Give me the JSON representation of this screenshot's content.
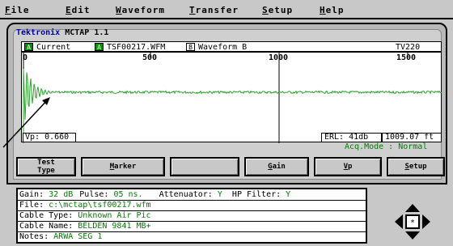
{
  "menu": [
    "File",
    "Edit",
    "Waveform",
    "Transfer",
    "Setup",
    "Help"
  ],
  "window": {
    "brand": "Tektronix",
    "title": "MCTAP 1.1"
  },
  "waveforms": {
    "current": {
      "badge": "A",
      "label": "Current"
    },
    "file": {
      "badge": "A",
      "label": "TSF00217.WFM"
    },
    "waveform_b": {
      "badge": "B",
      "label": "Waveform B"
    },
    "model": "TV220"
  },
  "axis": {
    "ticks": [
      "0",
      "500",
      "1000",
      "1500"
    ]
  },
  "readouts": {
    "vp": "Vp: 0.660",
    "erl": "ERL: 41db",
    "length": "1009.07 ft",
    "acq_mode": "Acq.Mode : Normal"
  },
  "buttons": [
    {
      "line1": "Test",
      "line2": "Type"
    },
    {
      "line1": "Marker",
      "line2": ""
    },
    {
      "line1": "",
      "line2": ""
    },
    {
      "line1": "Gain",
      "line2": ""
    },
    {
      "line1": "Vp",
      "line2": ""
    },
    {
      "line1": "Setup",
      "line2": ""
    }
  ],
  "info": {
    "gain_label": "Gain:",
    "gain": "32 dB",
    "pulse_label": "Pulse:",
    "pulse": "05 ns.",
    "atten_label": "Attenuator:",
    "atten": "Y",
    "hp_label": "HP Filter:",
    "hp": "Y",
    "file_label": "File:",
    "file": "c:\\mctap\\tsf00217.wfm",
    "cable_type_label": "Cable Type:",
    "cable_type": "Unknown Air Pic",
    "cable_name_label": "Cable Name:",
    "cable_name": "BELDEN 9841 MB+",
    "notes_label": "Notes:",
    "notes": "ARWA SEG 1"
  },
  "colors": {
    "trace": "#2aa52a",
    "label_green": "#008000",
    "brand": "#0000b0"
  }
}
